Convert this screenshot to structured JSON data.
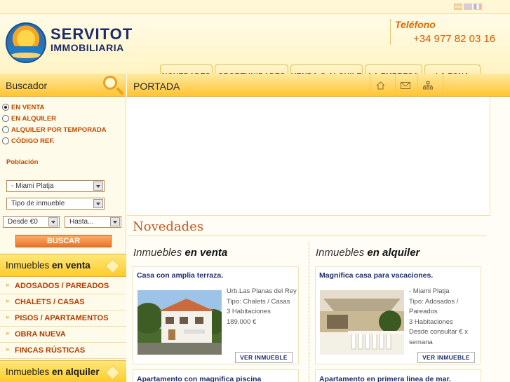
{
  "flags": [
    "flag-es-icon",
    "flag-uk-icon",
    "flag-fr-icon"
  ],
  "brand": {
    "name": "SERVITOT",
    "sub": "IMMOBILIARIA"
  },
  "phone": {
    "label": "Teléfono",
    "number": "+34 977 82 03 16"
  },
  "nav": {
    "tabs": [
      "NOVEDADES",
      "OPORTUNIDADES",
      "VENDA O ALQUILE",
      "LA EMPRESA",
      "LA ZONA"
    ]
  },
  "sidebar": {
    "title": "Buscador",
    "radios": [
      {
        "label": "EN VENTA",
        "checked": true
      },
      {
        "label": "EN ALQUILER",
        "checked": false
      },
      {
        "label": "ALQUILER POR TEMPORADA",
        "checked": false
      },
      {
        "label": "CÓDIGO REF.",
        "checked": false
      }
    ],
    "poblacion_label": "Población",
    "poblacion_value": "- Miami Platja",
    "tipo_value": "Tipo de inmueble",
    "desde_value": "Desde €0",
    "hasta_value": "Hasta...",
    "buscar_label": "BUSCAR",
    "venta_head": {
      "pre": "Inmuebles ",
      "strong": "en venta"
    },
    "venta_items": [
      "ADOSADOS / PAREADOS",
      "CHALETS / CASAS",
      "PISOS / APARTAMENTOS",
      "OBRA NUEVA",
      "FINCAS RÚSTICAS"
    ],
    "alquiler_head": {
      "pre": "Inmuebles ",
      "strong": "en alquiler"
    }
  },
  "main": {
    "portada_title": "PORTADA",
    "toolbar_icons": [
      "home-icon",
      "mail-icon",
      "sitemap-icon"
    ],
    "novedades_title": "Novedades",
    "venta_col": {
      "pre": "Inmuebles ",
      "strong": "en venta"
    },
    "alquiler_col": {
      "pre": "Inmuebles ",
      "strong": "en alquiler"
    },
    "cards": [
      {
        "title": "Casa con amplia terraza.",
        "lines": [
          "Urb.Las Planas del Rey",
          "Tipo: Chalets / Casas",
          "3 Habitaciones",
          "189.000 €"
        ],
        "button": "VER INMUEBLE"
      },
      {
        "title": "Magnifica casa para vacaciones.",
        "lines": [
          "- Miami Platja",
          "Tipo: Adosados / Pareados",
          "3 Habitaciones",
          "Desde consultar € x semana"
        ],
        "button": "VER INMUEBLE"
      }
    ],
    "cards_bottom": [
      "Apartamento con magnifica piscina",
      "Apartamento en primera linea de mar."
    ]
  }
}
